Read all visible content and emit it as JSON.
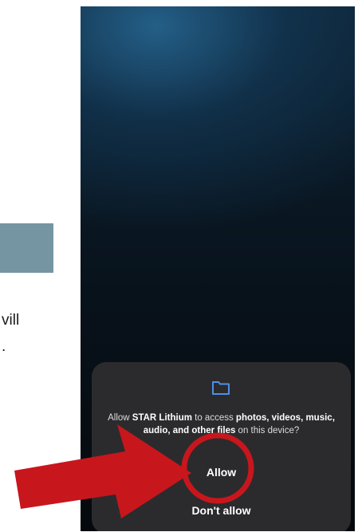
{
  "background_page": {
    "text_lines": [
      "vill",
      "."
    ]
  },
  "permission_dialog": {
    "icon": "folder-icon",
    "message_prefix": "Allow ",
    "app_name": "STAR Lithium",
    "message_mid": " to access ",
    "emphasis": "photos, videos, music, audio, and other files",
    "message_suffix": " on this device?",
    "allow_label": "Allow",
    "deny_label": "Don't allow"
  },
  "colors": {
    "annotation_red": "#c8161d",
    "sheet_background": "#2b2b2d",
    "folder_icon": "#4f8fe6"
  }
}
